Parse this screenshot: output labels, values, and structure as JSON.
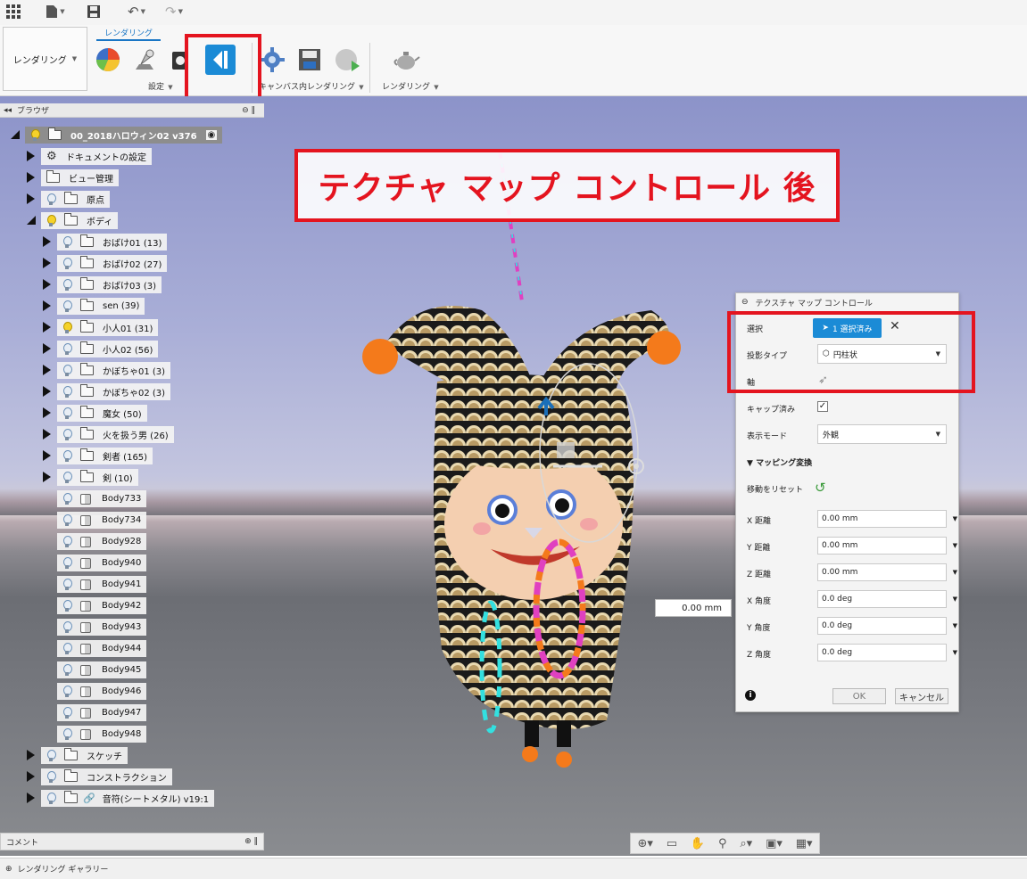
{
  "ribbon": {
    "workspace_label": "レンダリング",
    "tab_label": "レンダリング",
    "group_settings": "設定",
    "group_canvas": "キャンバス内レンダリング",
    "group_render": "レンダリング"
  },
  "browser": {
    "title": "ブラウザ",
    "root": "00_2018ハロウィン02 v376",
    "doc_settings": "ドキュメントの設定",
    "view_mgmt": "ビュー管理",
    "origin": "原点",
    "bodies": "ボディ",
    "folders": [
      "おばけ01 (13)",
      "おばけ02 (27)",
      "おばけ03 (3)",
      "sen (39)",
      "小人01 (31)",
      "小人02 (56)",
      "かぼちゃ01 (3)",
      "かぼちゃ02 (3)",
      "魔女 (50)",
      "火を扱う男 (26)",
      "剣者 (165)",
      "剣 (10)"
    ],
    "body_items": [
      "Body733",
      "Body734",
      "Body928",
      "Body940",
      "Body941",
      "Body942",
      "Body943",
      "Body944",
      "Body945",
      "Body946",
      "Body947",
      "Body948"
    ],
    "sketch": "スケッチ",
    "construction": "コンストラクション",
    "linked": "音符(シートメタル) v19:1"
  },
  "comment_label": "コメント",
  "gallery_label": "レンダリング ギャラリー",
  "annotation_title": "テクチャ マップ コントロール 後",
  "distance_value": "0.00 mm",
  "dialog": {
    "title": "テクスチャ マップ コントロール",
    "select_label": "選択",
    "select_value": "1 選択済み",
    "projection_label": "投影タイプ",
    "projection_value": "円柱状",
    "axis_label": "軸",
    "capped_label": "キャップ済み",
    "display_mode_label": "表示モード",
    "display_mode_value": "外観",
    "mapping_header": "マッピング変換",
    "reset_move_label": "移動をリセット",
    "fields": [
      {
        "label": "X 距離",
        "value": "0.00 mm"
      },
      {
        "label": "Y 距離",
        "value": "0.00 mm"
      },
      {
        "label": "Z 距離",
        "value": "0.00 mm"
      },
      {
        "label": "X 角度",
        "value": "0.0 deg"
      },
      {
        "label": "Y 角度",
        "value": "0.0 deg"
      },
      {
        "label": "Z 角度",
        "value": "0.0 deg"
      }
    ],
    "ok_label": "OK",
    "cancel_label": "キャンセル"
  },
  "colors": {
    "accent_red": "#e4141f",
    "accent_blue": "#1b8bd6"
  }
}
